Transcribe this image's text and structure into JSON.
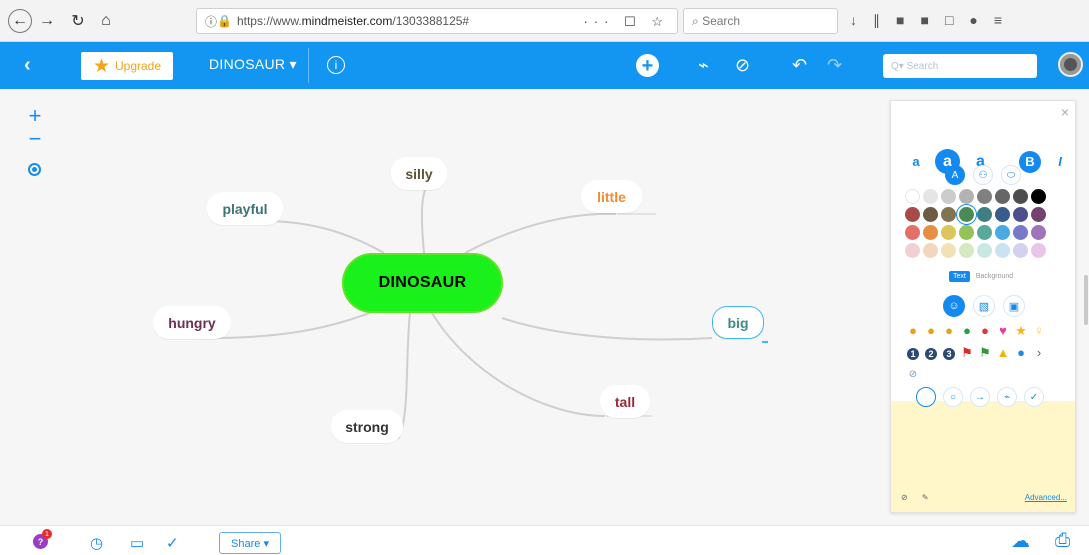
{
  "browser": {
    "url_prefix": "https://www.",
    "url_domain": "mindmeister.com",
    "url_suffix": "/1303388125#",
    "search_placeholder": "Search",
    "url_actions": "··· ☐ ☆"
  },
  "app": {
    "upgrade_label": "Upgrade",
    "map_title": "DINOSAUR ▾",
    "search_placeholder": "Q▾ Search"
  },
  "mindmap": {
    "root": "DINOSAUR",
    "nodes": [
      {
        "label": "silly",
        "color": "#5c5233"
      },
      {
        "label": "little",
        "color": "#ef8d32"
      },
      {
        "label": "playful",
        "color": "#3d7375"
      },
      {
        "label": "hungry",
        "color": "#6b2f56"
      },
      {
        "label": "big",
        "color": "#3b8d86"
      },
      {
        "label": "tall",
        "color": "#9a2934"
      },
      {
        "label": "strong",
        "color": "#333333"
      }
    ]
  },
  "format_panel": {
    "text_sizes": [
      "a",
      "a",
      "a"
    ],
    "bold": "B",
    "italic": "I",
    "tab_text": "Text",
    "tab_background": "Background",
    "advanced": "Advanced..."
  },
  "colors": {
    "accent": "#1296f2",
    "root_green": "#1af019",
    "palette": [
      "#ffffff",
      "#e5e5e5",
      "#cccccc",
      "#b3b3b3",
      "#808080",
      "#666666",
      "#4d4d4d",
      "#000000",
      "#a94a4a",
      "#6e5b43",
      "#80754f",
      "#4a8b54",
      "#3f7f80",
      "#385d8c",
      "#4d4f8c",
      "#74426f",
      "#e37066",
      "#e48f45",
      "#dac65a",
      "#95c35a",
      "#59a99b",
      "#4aa9e1",
      "#7779c9",
      "#a173b8",
      "#f0d0d0",
      "#f2d6bd",
      "#f0e2b4",
      "#d6e8c1",
      "#c9e8e2",
      "#c9e3f1",
      "#d3d2ee",
      "#e8c6e8"
    ]
  },
  "bottom": {
    "share_label": "Share ▾",
    "notification_count": "1"
  }
}
